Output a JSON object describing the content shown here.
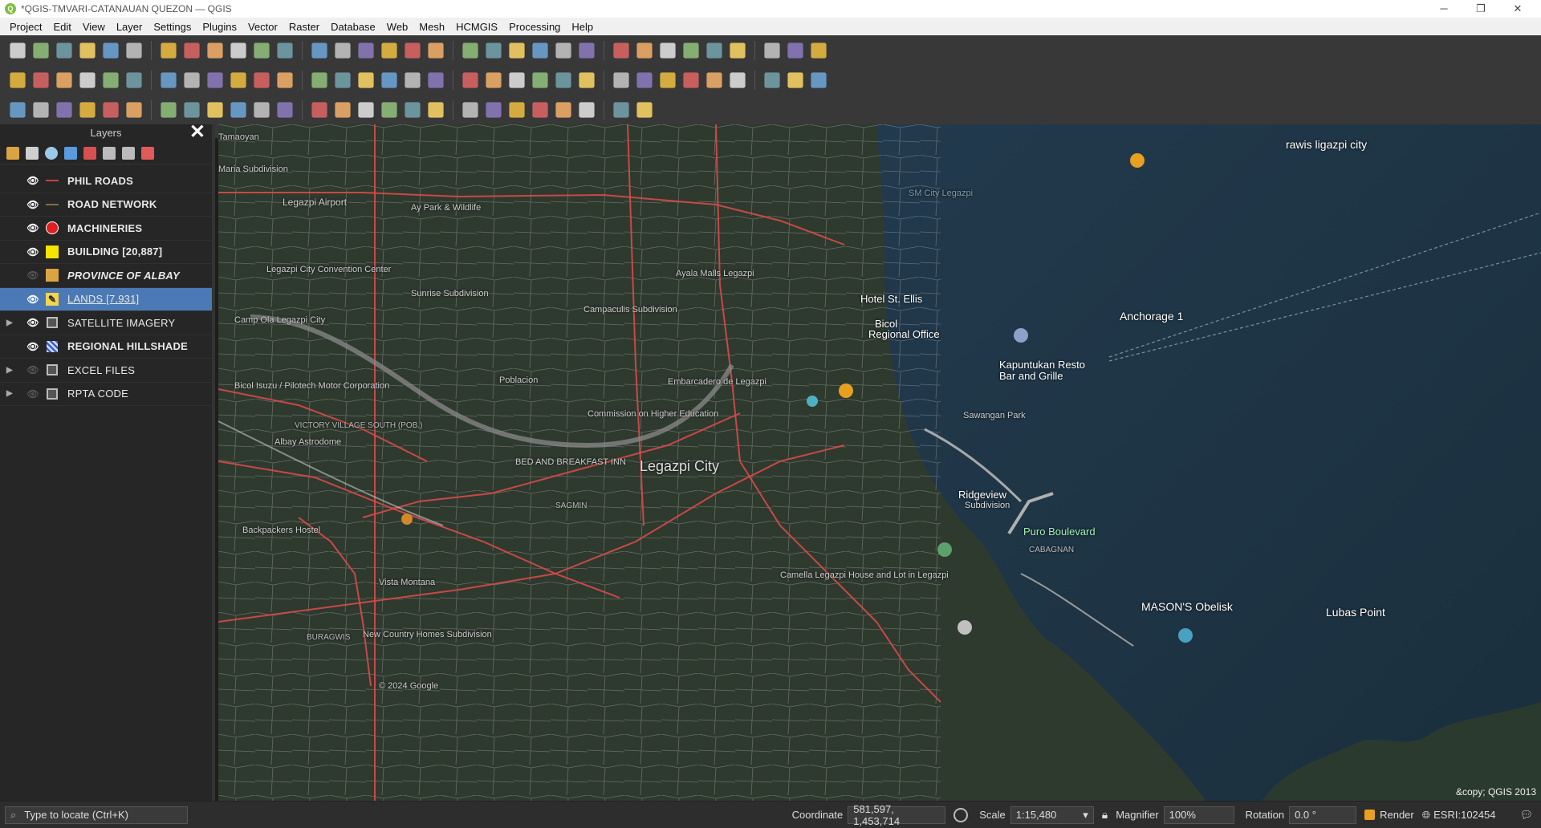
{
  "window": {
    "title": "*QGIS-TMVARI-CATANAUAN QUEZON — QGIS",
    "minimize": "─",
    "maximize": "❐",
    "close": "✕"
  },
  "menu": [
    "Project",
    "Edit",
    "View",
    "Layer",
    "Settings",
    "Plugins",
    "Vector",
    "Raster",
    "Database",
    "Web",
    "Mesh",
    "HCMGIS",
    "Processing",
    "Help"
  ],
  "layers_panel": {
    "title": "Layers",
    "close": "✕",
    "layers": [
      {
        "name": "PHIL ROADS",
        "visible": true,
        "symbol": "line-red",
        "style": "bold",
        "expandable": false
      },
      {
        "name": "ROAD NETWORK",
        "visible": true,
        "symbol": "line-brown",
        "style": "bold",
        "expandable": false
      },
      {
        "name": "MACHINERIES",
        "visible": true,
        "symbol": "dot-red",
        "style": "bold",
        "expandable": false
      },
      {
        "name": "BUILDING [20,887]",
        "visible": true,
        "symbol": "fill-yellow",
        "style": "bold",
        "expandable": false
      },
      {
        "name": "PROVINCE OF ALBAY",
        "visible": false,
        "symbol": "fill-orange",
        "style": "italic",
        "expandable": false
      },
      {
        "name": "LANDS [7,931]",
        "visible": true,
        "symbol": "edit-pencil",
        "style": "selected",
        "expandable": false
      },
      {
        "name": "SATELLITE IMAGERY",
        "visible": true,
        "symbol": "group",
        "style": "normal",
        "expandable": true
      },
      {
        "name": "REGIONAL HILLSHADE",
        "visible": true,
        "symbol": "raster",
        "style": "bold",
        "expandable": false
      },
      {
        "name": "EXCEL FILES",
        "visible": false,
        "symbol": "group",
        "style": "normal",
        "expandable": true
      },
      {
        "name": "RPTA CODE",
        "visible": false,
        "symbol": "group",
        "style": "normal",
        "expandable": true
      }
    ]
  },
  "map": {
    "labels": [
      {
        "text": "rawis ligazpi city",
        "kind": "poi"
      },
      {
        "text": "Anchorage 1",
        "kind": "poi"
      },
      {
        "text": "Kapuntukan Resto",
        "kind": "poi"
      },
      {
        "text": "Bar and Grille",
        "kind": "poi"
      },
      {
        "text": "Hotel St. Ellis",
        "kind": "place"
      },
      {
        "text": "Bicol",
        "kind": "place"
      },
      {
        "text": "Regional Office",
        "kind": "place"
      },
      {
        "text": "Legazpi City",
        "kind": "city"
      },
      {
        "text": "Ridgeview",
        "kind": "place"
      },
      {
        "text": "Subdivision",
        "kind": "place"
      },
      {
        "text": "Puro Boulevard",
        "kind": "poi"
      },
      {
        "text": "MASON'S Obelisk",
        "kind": "poi"
      },
      {
        "text": "Lubas Point",
        "kind": "poi"
      },
      {
        "text": "Legazpi Airport",
        "kind": "place"
      },
      {
        "text": "Legazpi City Convention Center",
        "kind": "place"
      },
      {
        "text": "Embarcadero de Legazpi",
        "kind": "place"
      },
      {
        "text": "Sawangan Park",
        "kind": "place"
      },
      {
        "text": "Camp Ola Legazpi City",
        "kind": "place"
      },
      {
        "text": "Albay Astrodome",
        "kind": "place"
      },
      {
        "text": "Backpackers Hostel",
        "kind": "place"
      },
      {
        "text": "Vista Montana",
        "kind": "place"
      },
      {
        "text": "New Country Homes Subdivision",
        "kind": "place"
      },
      {
        "text": "Camella Legazpi House and Lot in Legazpi",
        "kind": "place"
      },
      {
        "text": "BURAGWIS",
        "kind": "brgy"
      },
      {
        "text": "CABAGNAN",
        "kind": "brgy"
      },
      {
        "text": "VICTORY VILLAGE SOUTH (POB.)",
        "kind": "brgy"
      },
      {
        "text": "SAGMIN",
        "kind": "brgy"
      },
      {
        "text": "Tamaoyan",
        "kind": "brgy"
      },
      {
        "text": "Maria Subdivision",
        "kind": "place"
      },
      {
        "text": "Ay Park & Wildlife",
        "kind": "place"
      },
      {
        "text": "Sunrise Subdivision",
        "kind": "place"
      },
      {
        "text": "Campaculis Subdivision",
        "kind": "place"
      },
      {
        "text": "Ayala Malls Legazpi",
        "kind": "place"
      },
      {
        "text": "Bicol Isuzu / Pilotech Motor Corporation",
        "kind": "place"
      },
      {
        "text": "Commission on Higher Education",
        "kind": "place"
      },
      {
        "text": "BED AND BREAKFAST INN",
        "kind": "place"
      },
      {
        "text": "Poblacion",
        "kind": "place"
      },
      {
        "text": "SM City Legazpi",
        "kind": "place"
      },
      {
        "text": "© 2024 Google",
        "kind": "watermark"
      }
    ],
    "attribution": "&copy; QGIS 2013"
  },
  "statusbar": {
    "locator_placeholder": "Type to locate (Ctrl+K)",
    "coordinate_label": "Coordinate",
    "coordinate_value": "581,597, 1,453,714",
    "scale_label": "Scale",
    "scale_value": "1:15,480",
    "magnifier_label": "Magnifier",
    "magnifier_value": "100%",
    "rotation_label": "Rotation",
    "rotation_value": "0.0 °",
    "render_label": "Render",
    "crs": "ESRI:102454"
  },
  "colors": {
    "selected_layer": "#4a79b5",
    "road_red": "#d84a4a",
    "sea": "#1d3444",
    "land": "#2f3a2f"
  }
}
